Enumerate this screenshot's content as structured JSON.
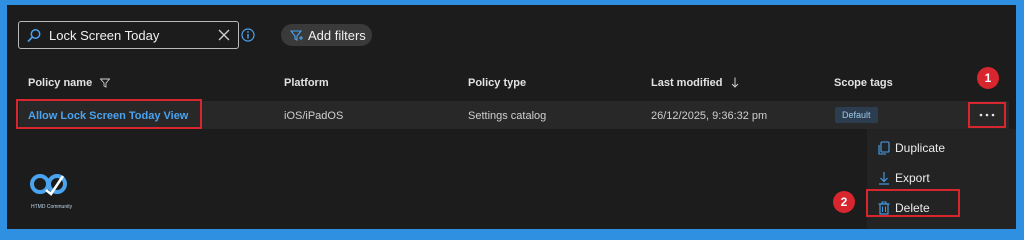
{
  "search": {
    "value": "Lock Screen Today"
  },
  "toolbar": {
    "add_filters_label": "Add filters"
  },
  "table": {
    "columns": [
      "Policy name",
      "Platform",
      "Policy type",
      "Last modified",
      "Scope tags"
    ],
    "rows": [
      {
        "policy_name": "Allow Lock Screen Today View",
        "platform": "iOS/iPadOS",
        "policy_type": "Settings catalog",
        "last_modified": "26/12/2025, 9:36:32 pm",
        "scope_tag": "Default"
      }
    ]
  },
  "context_menu": {
    "items": [
      {
        "label": "Duplicate",
        "icon": "duplicate-icon"
      },
      {
        "label": "Export",
        "icon": "download-icon"
      },
      {
        "label": "Delete",
        "icon": "trash-icon"
      }
    ]
  },
  "callouts": [
    "1",
    "2"
  ],
  "logo": {
    "text": "HTMD Community"
  },
  "colors": {
    "accent": "#4aa3ef",
    "highlight": "#d8262f",
    "frame": "#2f8fe0"
  }
}
